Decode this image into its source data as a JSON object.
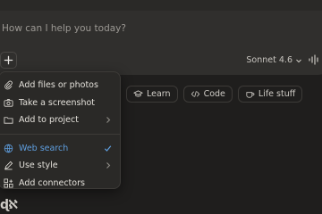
{
  "composer": {
    "placeholder": "How can I help you today?",
    "model_label": "Sonnet 4.6"
  },
  "menu": {
    "items": [
      {
        "label": "Add files or photos",
        "icon": "paperclip-icon"
      },
      {
        "label": "Take a screenshot",
        "icon": "camera-icon"
      },
      {
        "label": "Add to project",
        "icon": "folder-icon",
        "submenu": true
      },
      {
        "label": "Web search",
        "icon": "globe-icon",
        "checked": true,
        "active": true
      },
      {
        "label": "Use style",
        "icon": "pen-icon",
        "submenu": true
      },
      {
        "label": "Add connectors",
        "icon": "connectors-icon"
      }
    ]
  },
  "chips": [
    {
      "label": "Learn",
      "icon": "graduation-cap-icon"
    },
    {
      "label": "Code",
      "icon": "code-icon"
    },
    {
      "label": "Life stuff",
      "icon": "coffee-cup-icon"
    }
  ],
  "colors": {
    "background": "#1f1e1d",
    "composer": "#302f2d",
    "menu": "#2a2927",
    "accent_active": "#5f9fe0"
  },
  "logo_text": "ɖℵ"
}
